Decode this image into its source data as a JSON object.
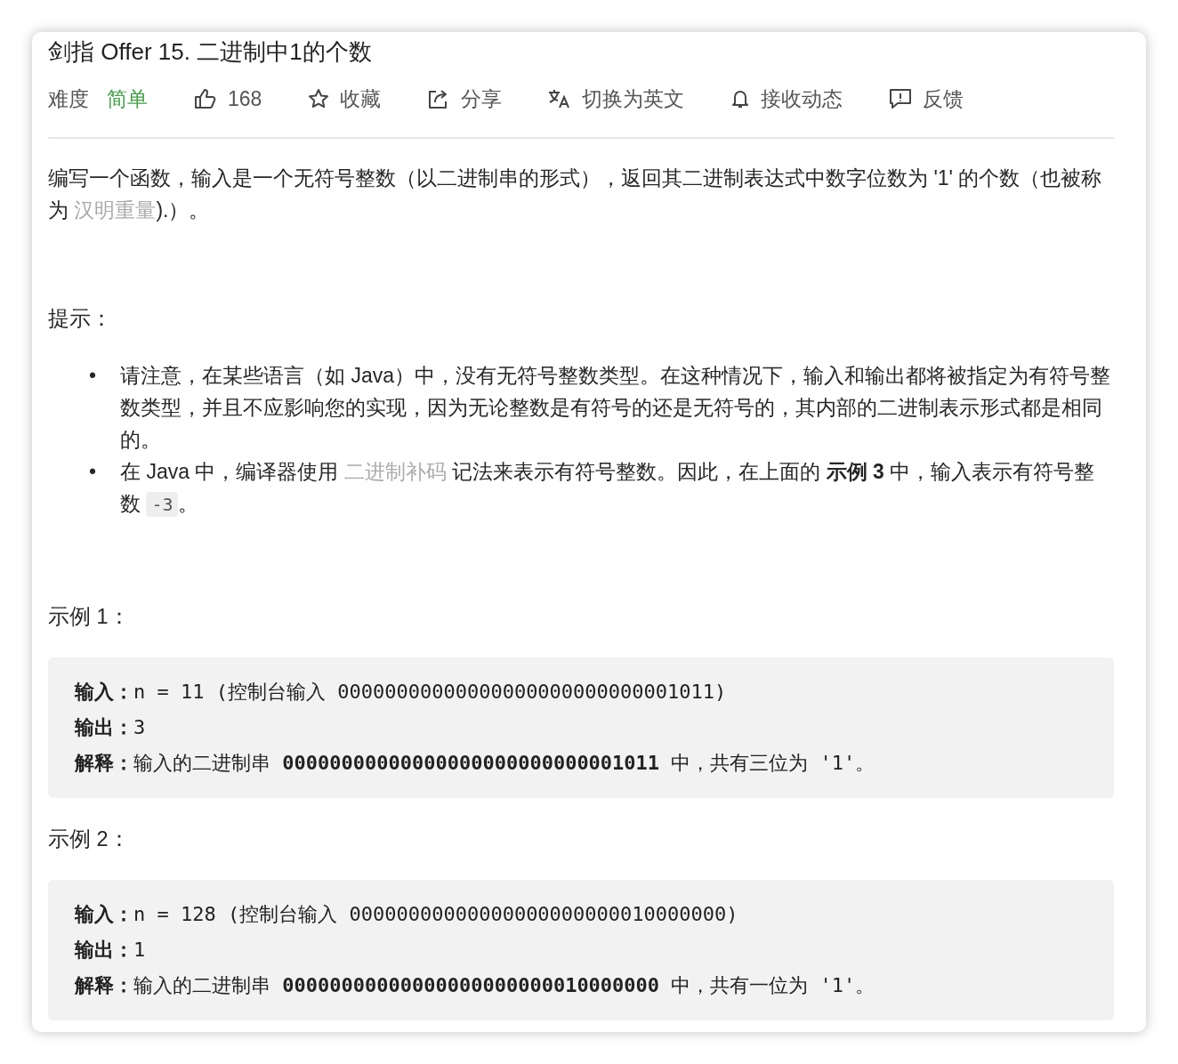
{
  "title": "剑指 Offer 15. 二进制中1的个数",
  "toolbar": [
    {
      "kind": "difficulty",
      "label": "难度",
      "value": "简单"
    },
    {
      "kind": "like",
      "label": "168"
    },
    {
      "kind": "star",
      "label": "收藏"
    },
    {
      "kind": "share",
      "label": "分享"
    },
    {
      "kind": "translate",
      "label": "切换为英文"
    },
    {
      "kind": "bell",
      "label": "接收动态"
    },
    {
      "kind": "feedback",
      "label": "反馈"
    }
  ],
  "description": [
    {
      "kind": "text",
      "text": "编写一个函数，输入是一个无符号整数（以二进制串的形式），返回其二进制表达式中数字位数为 '1' 的个数（也被称为 "
    },
    {
      "kind": "link",
      "text": "汉明重量"
    },
    {
      "kind": "text",
      "text": ").）。"
    }
  ],
  "hints_heading": "提示：",
  "hints": [
    {
      "marker": "•",
      "segments": [
        {
          "kind": "text",
          "text": "请注意，在某些语言（如 Java）中，没有无符号整数类型。在这种情况下，输入和输出都将被指定为有符号整数类型，并且不应影响您的实现，因为无论整数是有符号的还是无符号的，其内部的二进制表示形式都是相同的。"
        }
      ]
    },
    {
      "marker": "•",
      "segments": [
        {
          "kind": "text",
          "text": "在 Java 中，编译器使用 "
        },
        {
          "kind": "link",
          "text": "二进制补码"
        },
        {
          "kind": "text",
          "text": " 记法来表示有符号整数。因此，在上面的 **示例 3** 中，输入表示有符号整数 "
        },
        {
          "kind": "code",
          "text": "-3"
        },
        {
          "kind": "text",
          "text": "。"
        }
      ]
    }
  ],
  "examples": [
    {
      "heading": "示例 1：",
      "lines": [
        "**输入：**n = 11 (控制台输入 00000000000000000000000000001011)",
        "**输出：**3",
        "**解释：**输入的二进制串 **00000000000000000000000000001011** 中，共有三位为 '1'。"
      ]
    },
    {
      "heading": "示例 2：",
      "lines": [
        "**输入：**n = 128 (控制台输入 00000000000000000000000010000000)",
        "**输出：**1",
        "**解释：**输入的二进制串 **00000000000000000000000010000000** 中，共有一位为 '1'。"
      ]
    }
  ]
}
